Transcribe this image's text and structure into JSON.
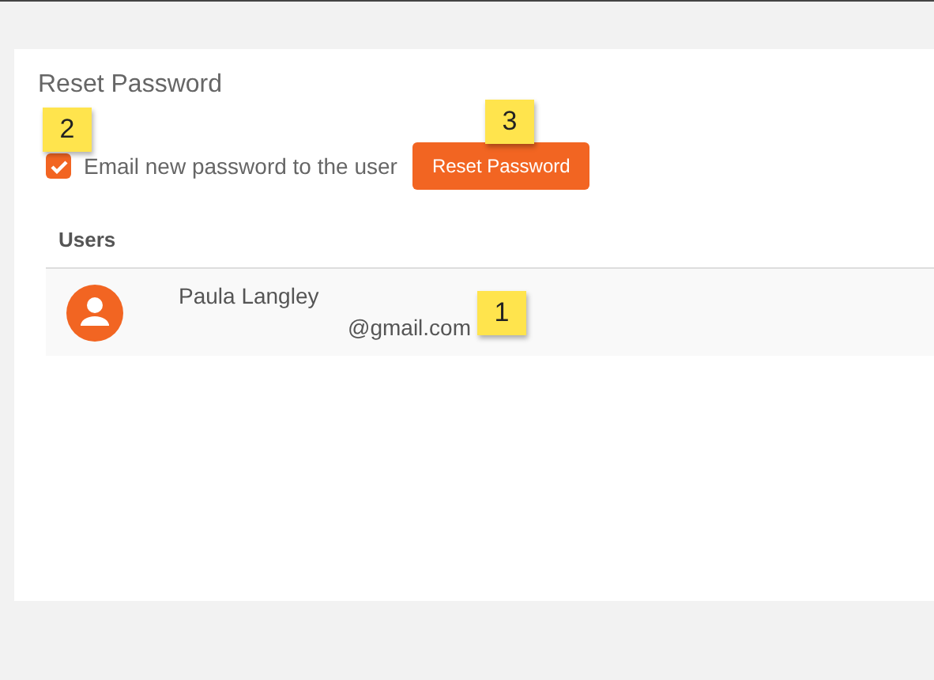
{
  "panel": {
    "title": "Reset Password"
  },
  "email_option": {
    "label": "Email new password to the user",
    "checked": true,
    "callout": "2"
  },
  "reset_button": {
    "label": "Reset Password",
    "callout": "3"
  },
  "users": {
    "heading": "Users",
    "rows": [
      {
        "name": "Paula Langley",
        "email": "@gmail.com",
        "callout": "1"
      }
    ]
  }
}
